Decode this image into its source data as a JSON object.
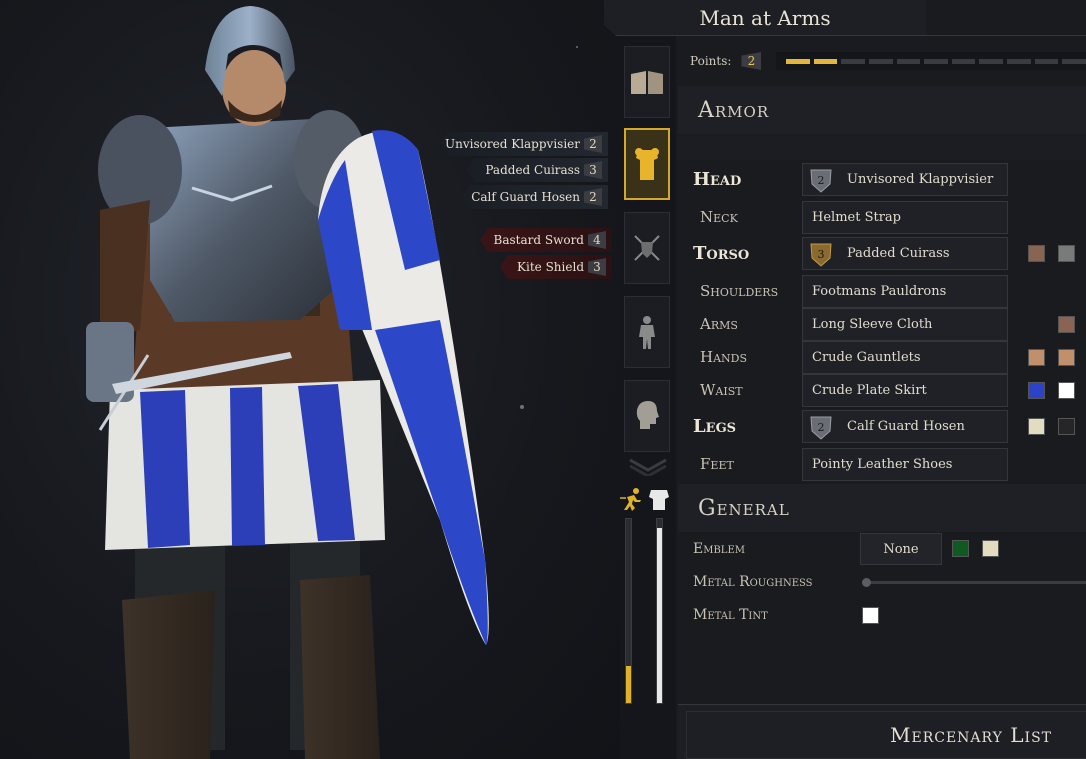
{
  "title": "Man at Arms",
  "points": {
    "label": "Points:",
    "value": "2",
    "pips_total": 11,
    "pips_filled": 2
  },
  "loadout_tags": {
    "armor": [
      {
        "name": "Unvisored Klappvisier",
        "cost": "2"
      },
      {
        "name": "Padded Cuirass",
        "cost": "3"
      },
      {
        "name": "Calf Guard Hosen",
        "cost": "2"
      }
    ],
    "weapons": [
      {
        "name": "Bastard Sword",
        "cost": "4"
      },
      {
        "name": "Kite Shield",
        "cost": "3"
      }
    ]
  },
  "categories": [
    {
      "icon": "book-icon",
      "active": false
    },
    {
      "icon": "armor-icon",
      "active": true
    },
    {
      "icon": "crossed-swords-shield-icon",
      "active": false
    },
    {
      "icon": "body-silhouette-icon",
      "active": false
    },
    {
      "icon": "head-profile-icon",
      "active": false
    }
  ],
  "stats": {
    "speed_fraction": 0.2,
    "armor_fraction": 0.95,
    "speed_color": "#e0b22a",
    "armor_color": "#e8e8e8"
  },
  "armor_section": {
    "title": "Armor",
    "slots": {
      "head": {
        "label": "Head",
        "item": "Unvisored Klappvisier",
        "badge": "2"
      },
      "neck": {
        "label": "Neck",
        "item": "Helmet Strap"
      },
      "torso": {
        "label": "Torso",
        "item": "Padded Cuirass",
        "badge": "3"
      },
      "shoulders": {
        "label": "Shoulders",
        "item": "Footmans Pauldrons"
      },
      "arms": {
        "label": "Arms",
        "item": "Long Sleeve Cloth"
      },
      "hands": {
        "label": "Hands",
        "item": "Crude Gauntlets"
      },
      "waist": {
        "label": "Waist",
        "item": "Crude Plate Skirt"
      },
      "legs": {
        "label": "Legs",
        "item": "Calf Guard Hosen",
        "badge": "2"
      },
      "feet": {
        "label": "Feet",
        "item": "Pointy Leather Shoes"
      }
    }
  },
  "general_section": {
    "title": "General",
    "emblem": {
      "label": "Emblem",
      "value": "None"
    },
    "metal_roughness": {
      "label": "Metal Roughness",
      "value": 0
    },
    "metal_tint": {
      "label": "Metal Tint"
    }
  },
  "colors": {
    "torso": [
      "#8a6452",
      "#7a7a7a"
    ],
    "arms": [
      "#8a6452"
    ],
    "hands": [
      "#c0906c",
      "#c0906c"
    ],
    "waist": [
      "#2c42c8",
      "#ffffff"
    ],
    "legs": [
      "#e2dcc0",
      "#262626"
    ],
    "emblem": [
      "#0f5a22",
      "#e2dcc0"
    ],
    "metal_tint": "#ffffff"
  },
  "mercenary_list": "Mercenary List"
}
